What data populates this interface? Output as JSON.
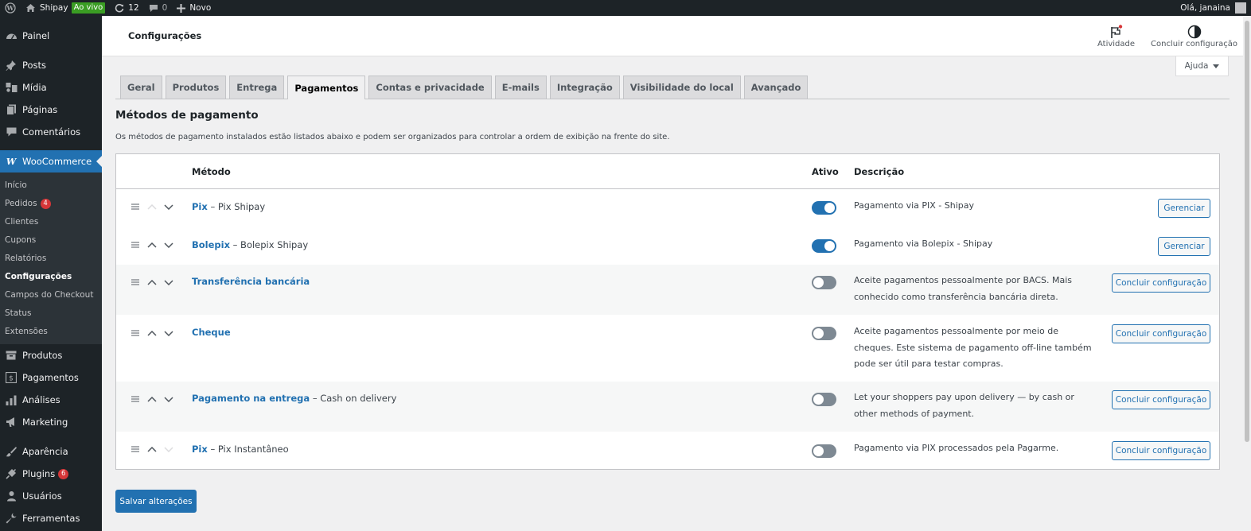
{
  "adminbar": {
    "site_name": "Shipay",
    "live_label": "Ao vivo",
    "updates_count": "12",
    "comments_count": "0",
    "new_label": "Novo",
    "greeting": "Olá, janaina"
  },
  "sidebar": {
    "items_top": [
      {
        "label": "Painel",
        "icon": "dashboard-icon"
      },
      {
        "label": "Posts",
        "icon": "pin-icon"
      },
      {
        "label": "Mídia",
        "icon": "media-icon"
      },
      {
        "label": "Páginas",
        "icon": "page-icon"
      },
      {
        "label": "Comentários",
        "icon": "comment-icon"
      }
    ],
    "woocommerce_label": "WooCommerce",
    "submenu": [
      {
        "label": "Início"
      },
      {
        "label": "Pedidos",
        "badge": "4"
      },
      {
        "label": "Clientes"
      },
      {
        "label": "Cupons"
      },
      {
        "label": "Relatórios"
      },
      {
        "label": "Configurações",
        "current": true
      },
      {
        "label": "Campos do Checkout"
      },
      {
        "label": "Status"
      },
      {
        "label": "Extensões"
      }
    ],
    "items_bottom": [
      {
        "label": "Produtos",
        "icon": "products-icon"
      },
      {
        "label": "Pagamentos",
        "icon": "payments-icon"
      },
      {
        "label": "Análises",
        "icon": "analytics-icon"
      },
      {
        "label": "Marketing",
        "icon": "megaphone-icon"
      },
      {
        "label": "Aparência",
        "icon": "brush-icon"
      },
      {
        "label": "Plugins",
        "icon": "plugin-icon",
        "badge": "6"
      },
      {
        "label": "Usuários",
        "icon": "users-icon"
      },
      {
        "label": "Ferramentas",
        "icon": "tools-icon"
      }
    ]
  },
  "header": {
    "title": "Configurações",
    "activity_label": "Atividade",
    "finish_setup_label": "Concluir configuração",
    "help_label": "Ajuda"
  },
  "tabs": [
    {
      "label": "Geral"
    },
    {
      "label": "Produtos"
    },
    {
      "label": "Entrega"
    },
    {
      "label": "Pagamentos",
      "active": true
    },
    {
      "label": "Contas e privacidade"
    },
    {
      "label": "E-mails"
    },
    {
      "label": "Integração"
    },
    {
      "label": "Visibilidade do local"
    },
    {
      "label": "Avançado"
    }
  ],
  "section": {
    "title": "Métodos de pagamento",
    "description": "Os métodos de pagamento instalados estão listados abaixo e podem ser organizados para controlar a ordem de exibição na frente do site."
  },
  "table": {
    "col_method": "Método",
    "col_active": "Ativo",
    "col_description": "Descrição",
    "rows": [
      {
        "name": "Pix",
        "subtitle": "– Pix Shipay",
        "enabled": true,
        "description": "Pagamento via PIX - Shipay",
        "action": "Gerenciar"
      },
      {
        "name": "Bolepix",
        "subtitle": "– Bolepix Shipay",
        "enabled": true,
        "description": "Pagamento via Bolepix - Shipay",
        "action": "Gerenciar"
      },
      {
        "name": "Transferência bancária",
        "subtitle": "",
        "enabled": false,
        "description": "Aceite pagamentos pessoalmente por BACS. Mais conhecido como transferência bancária direta.",
        "action": "Concluir configuração"
      },
      {
        "name": "Cheque",
        "subtitle": "",
        "enabled": false,
        "description": "Aceite pagamentos pessoalmente por meio de cheques. Este sistema de pagamento off-line também pode ser útil para testar compras.",
        "action": "Concluir configuração"
      },
      {
        "name": "Pagamento na entrega",
        "subtitle": "– Cash on delivery",
        "enabled": false,
        "description": "Let your shoppers pay upon delivery — by cash or other methods of payment.",
        "action": "Concluir configuração"
      },
      {
        "name": "Pix",
        "subtitle": "– Pix Instantâneo",
        "enabled": false,
        "description": "Pagamento via PIX processados pela Pagarme.",
        "action": "Concluir configuração"
      }
    ]
  },
  "save_label": "Salvar alterações"
}
